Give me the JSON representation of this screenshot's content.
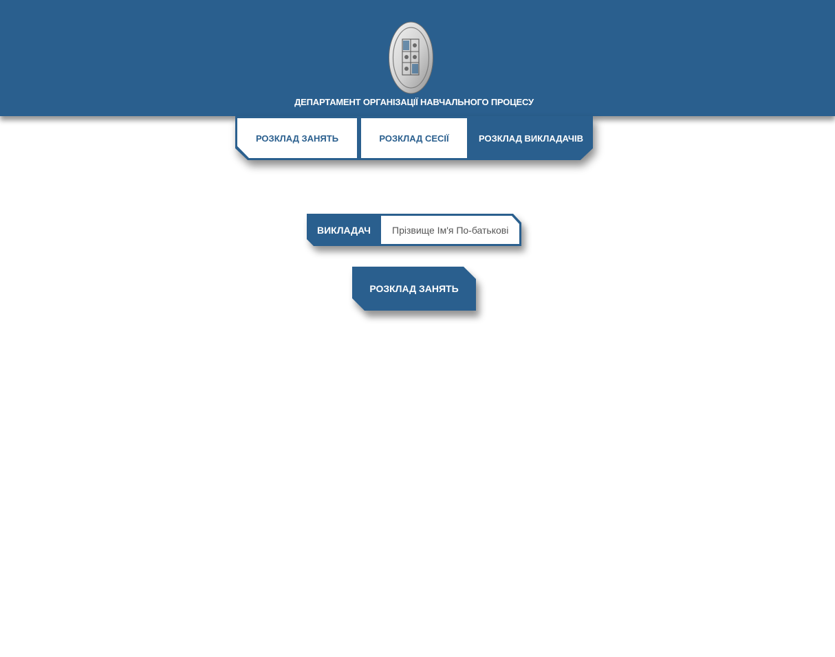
{
  "header": {
    "department_title": "ДЕПАРТАМЕНТ ОРГАНІЗАЦІЇ НАВЧАЛЬНОГО ПРОЦЕСУ",
    "logo_icon": "university-seal-icon"
  },
  "nav": {
    "tabs": [
      {
        "label": "РОЗКЛАД ЗАНЯТЬ",
        "active": false
      },
      {
        "label": "РОЗКЛАД СЕСІЇ",
        "active": false
      },
      {
        "label": "РОЗКЛАД ВИКЛАДАЧІВ",
        "active": true
      }
    ]
  },
  "search": {
    "label": "ВИКЛАДАЧ",
    "placeholder": "Прізвище Ім'я По-батькові",
    "value": ""
  },
  "actions": {
    "schedule_button_label": "РОЗКЛАД ЗАНЯТЬ"
  },
  "colors": {
    "primary": "#2a5f8e",
    "background": "#ffffff",
    "text_on_primary": "#ffffff"
  }
}
